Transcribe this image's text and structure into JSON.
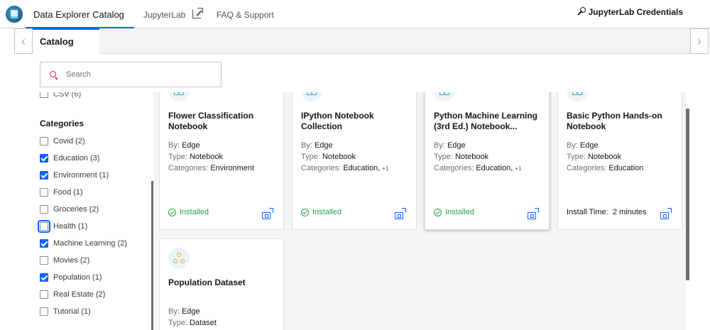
{
  "nav": {
    "tabs": [
      {
        "label": "Data Explorer Catalog"
      },
      {
        "label": "JupyterLab"
      },
      {
        "label": "FAQ & Support"
      }
    ],
    "credentials_label": "JupyterLab Credentials"
  },
  "tabbar": {
    "active_tab": "Catalog"
  },
  "search": {
    "placeholder": "Search"
  },
  "sidebar": {
    "cut_item": "CSV (6)",
    "categories_heading": "Categories",
    "categories": [
      {
        "label": "Covid (2)",
        "checked": false
      },
      {
        "label": "Education (3)",
        "checked": true
      },
      {
        "label": "Environment (1)",
        "checked": true
      },
      {
        "label": "Food (1)",
        "checked": false
      },
      {
        "label": "Groceries (2)",
        "checked": false
      },
      {
        "label": "Health (1)",
        "checked": false,
        "focused": true
      },
      {
        "label": "Machine Learning (2)",
        "checked": true
      },
      {
        "label": "Movies (2)",
        "checked": false
      },
      {
        "label": "Population (1)",
        "checked": true
      },
      {
        "label": "Real Estate (2)",
        "checked": false
      },
      {
        "label": "Tutorial (1)",
        "checked": false
      }
    ]
  },
  "labels": {
    "by": "By:",
    "type": "Type:",
    "categories": "Categories:",
    "install_time": "Install Time:"
  },
  "cards": [
    {
      "title": "Flower Classification Notebook",
      "by": "Edge",
      "type": "Notebook",
      "categories": "Environment",
      "extra": "",
      "status": "Installed",
      "icon": "notebook-icon"
    },
    {
      "title": "IPython Notebook Collection",
      "by": "Edge",
      "type": "Notebook",
      "categories": "Education,",
      "extra": "+1",
      "status": "Installed",
      "icon": "notebook-icon"
    },
    {
      "title": "Python Machine Learning (3rd Ed.) Notebook...",
      "by": "Edge",
      "type": "Notebook",
      "categories": "Education,",
      "extra": "+1",
      "status": "Installed",
      "icon": "notebook-icon"
    },
    {
      "title": "Basic Python Hands-on Notebook",
      "by": "Edge",
      "type": "Notebook",
      "categories": "Education",
      "extra": "",
      "install_time": "2 minutes",
      "icon": "notebook-icon"
    },
    {
      "title": "Population Dataset",
      "by": "Edge",
      "type": "Dataset",
      "icon": "dataset-icon"
    }
  ],
  "colors": {
    "accent": "#0f62fe",
    "installed": "#24a148",
    "notebook_icon": "#3aa6c0",
    "dataset_icon": "#f1a21b"
  }
}
